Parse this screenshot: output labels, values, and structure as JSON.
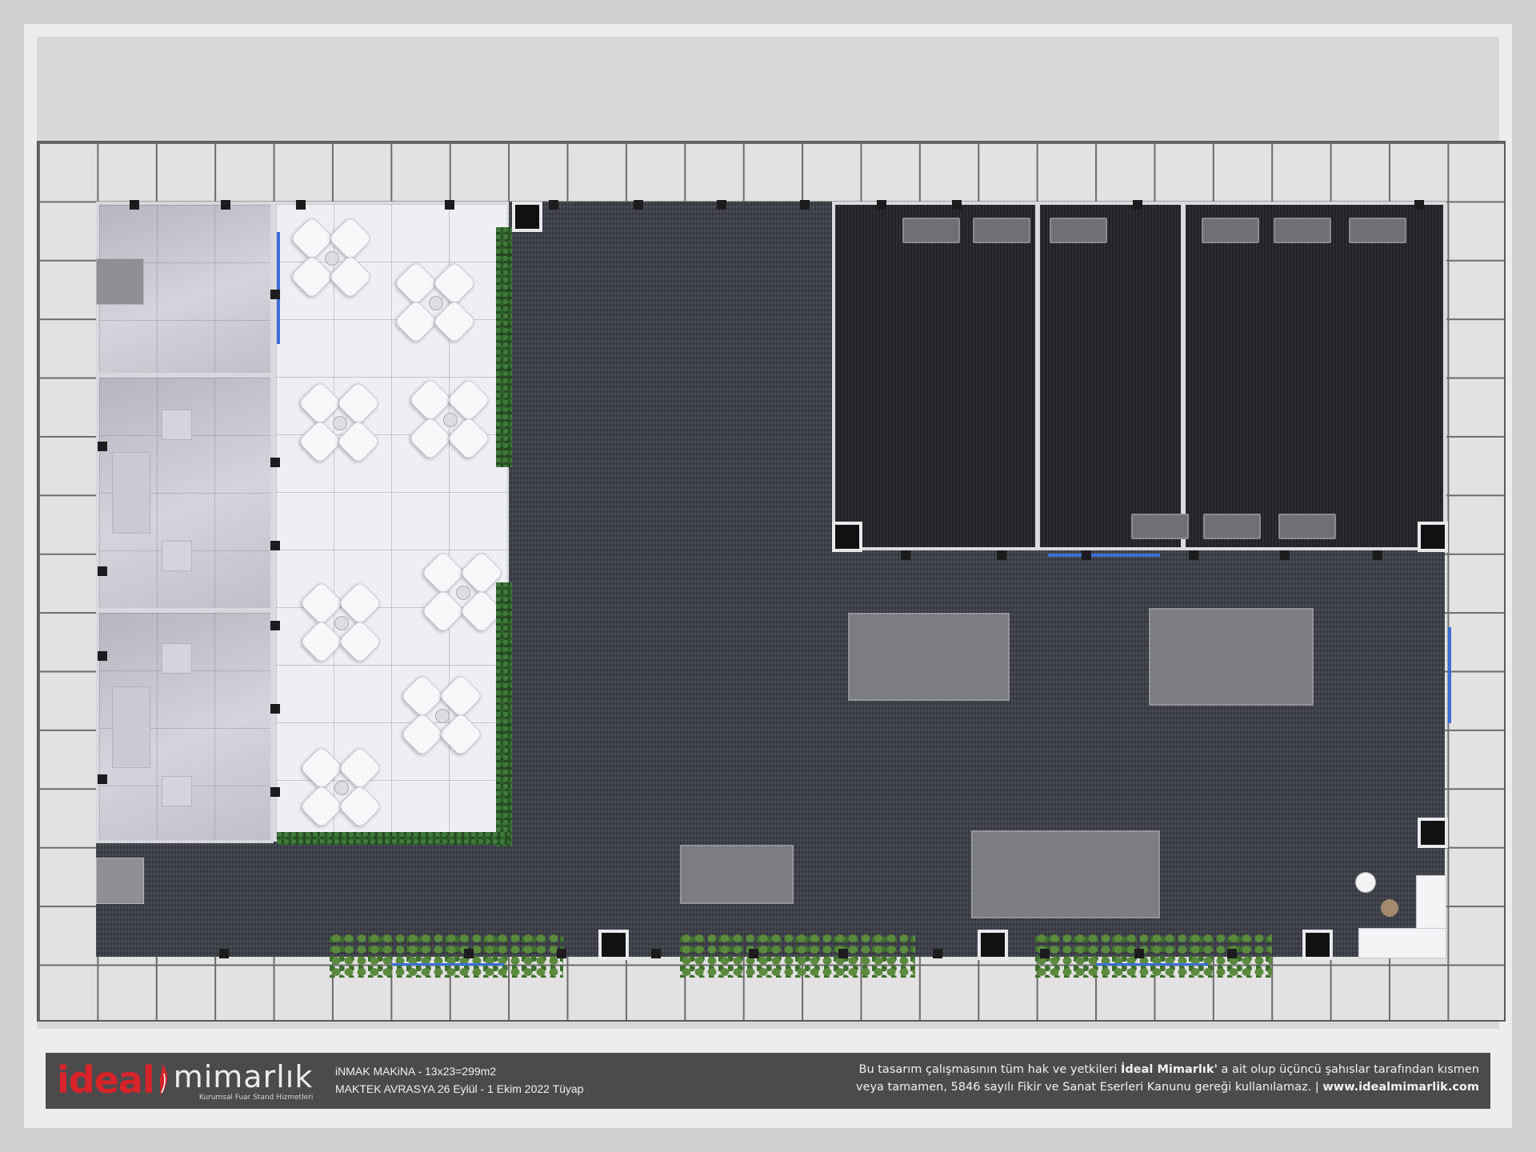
{
  "footer": {
    "logo_main": "ideal",
    "logo_brand": "mimarlık",
    "logo_tagline": "Kurumsal Fuar Stand Hizmetleri",
    "project_line1": "iNMAK MAKiNA - 13x23=299m2",
    "project_line2": "MAKTEK AVRASYA 26 Eylül - 1 Ekim 2022 Tüyap",
    "copyright_pre": "Bu tasarım çalışmasının tüm hak ve yetkileri ",
    "copyright_brand": "İdeal Mimarlık'",
    "copyright_post": " a ait olup üçüncü şahıslar tarafından kısmen",
    "copyright_line2_pre": "veya tamamen, 5846 sayılı Fikir ve Sanat Eserleri Kanunu gereği kullanılamaz. | ",
    "copyright_url": "www.idealmimarlik.com"
  },
  "colors": {
    "brand_red": "#d8232a",
    "carpet": "#3c3f48",
    "footer_bg": "#4b4b4d",
    "accent_blue": "#3a6fd8"
  }
}
